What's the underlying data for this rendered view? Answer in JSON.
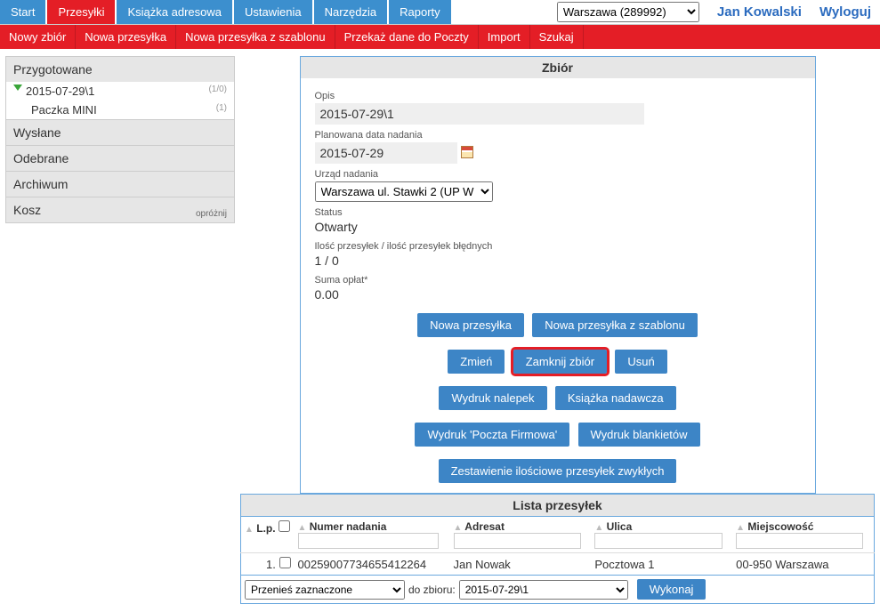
{
  "topbar": {
    "tabs": [
      "Start",
      "Przesyłki",
      "Książka adresowa",
      "Ustawienia",
      "Narzędzia",
      "Raporty"
    ],
    "active_tab_index": 1,
    "location": "Warszawa (289992)",
    "user": "Jan Kowalski",
    "logout": "Wyloguj"
  },
  "subbar": {
    "items": [
      "Nowy zbiór",
      "Nowa przesyłka",
      "Nowa przesyłka z szablonu",
      "Przekaż dane do Poczty",
      "Import",
      "Szukaj"
    ]
  },
  "sidebar": {
    "sections": {
      "prepared": {
        "title": "Przygotowane"
      },
      "sent": {
        "title": "Wysłane"
      },
      "received": {
        "title": "Odebrane"
      },
      "archive": {
        "title": "Archiwum"
      },
      "trash": {
        "title": "Kosz",
        "empty_link": "opróżnij"
      }
    },
    "items": [
      {
        "label": "2015-07-29\\1",
        "count": "(1/0)"
      },
      {
        "label": "Paczka MINI",
        "count": "(1)"
      }
    ]
  },
  "zbior": {
    "header": "Zbiór",
    "fields": {
      "opis_label": "Opis",
      "opis_value": "2015-07-29\\1",
      "data_label": "Planowana data nadania",
      "data_value": "2015-07-29",
      "urzad_label": "Urząd nadania",
      "urzad_value": "Warszawa ul. Stawki 2 (UP W",
      "status_label": "Status",
      "status_value": "Otwarty",
      "ilosc_label": "Ilość przesyłek / ilość przesyłek błędnych",
      "ilosc_value": "1 / 0",
      "suma_label": "Suma opłat*",
      "suma_value": "0.00"
    },
    "buttons": {
      "nowa": "Nowa przesyłka",
      "nowa_sz": "Nowa przesyłka z szablonu",
      "zmien": "Zmień",
      "zamknij": "Zamknij zbiór",
      "usun": "Usuń",
      "wydruk_nalepek": "Wydruk nalepek",
      "ksiazka": "Książka nadawcza",
      "wydruk_poczta": "Wydruk 'Poczta Firmowa'",
      "wydruk_blank": "Wydruk blankietów",
      "zestawienie": "Zestawienie ilościowe przesyłek zwykłych"
    }
  },
  "lista": {
    "header": "Lista przesyłek",
    "columns": {
      "lp": "L.p.",
      "numer": "Numer nadania",
      "adresat": "Adresat",
      "ulica": "Ulica",
      "miejscowosc": "Miejscowość"
    },
    "rows": [
      {
        "lp": "1.",
        "numer": "00259007734655412264",
        "adresat": "Jan Nowak",
        "ulica": "Pocztowa 1",
        "miejscowosc": "00-950 Warszawa"
      }
    ],
    "footer": {
      "przenies": "Przenieś zaznaczone",
      "do_zbioru_label": "do zbioru:",
      "do_zbioru_value": "2015-07-29\\1",
      "wykonaj": "Wykonaj"
    }
  }
}
